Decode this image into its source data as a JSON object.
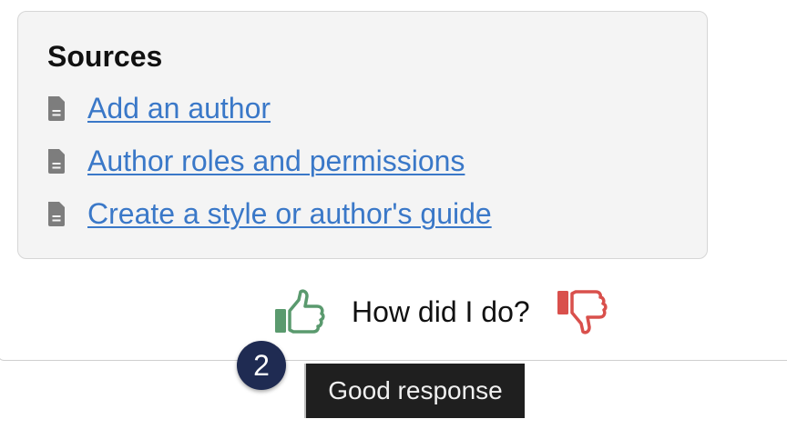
{
  "sources": {
    "title": "Sources",
    "items": [
      {
        "label": "Add an author",
        "icon": "document-icon"
      },
      {
        "label": "Author roles and permissions",
        "icon": "document-icon"
      },
      {
        "label": "Create a style or author's guide",
        "icon": "document-icon"
      }
    ]
  },
  "feedback": {
    "prompt": "How did I do?",
    "thumbs_up_icon": "thumbs-up-icon",
    "thumbs_down_icon": "thumbs-down-icon",
    "thumbs_up_color": "#5a9a6e",
    "thumbs_down_color": "#d9504c"
  },
  "step_badge": "2",
  "tooltip": "Good response",
  "colors": {
    "link": "#3a78c8",
    "badge": "#1f2b52",
    "tooltip_bg": "#1f1f1f"
  }
}
